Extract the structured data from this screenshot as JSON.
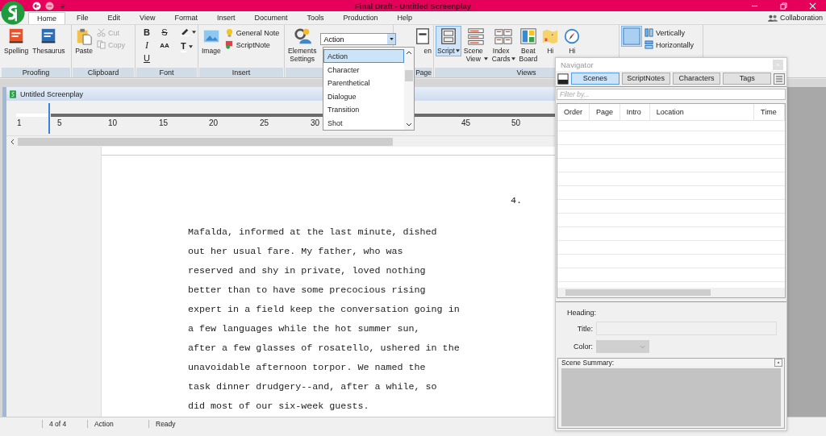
{
  "window": {
    "title": "Final Draft - Untitled Screenplay"
  },
  "menu_tabs": [
    {
      "label": "Home",
      "selected": true
    },
    {
      "label": "File",
      "selected": false
    },
    {
      "label": "Edit",
      "selected": false
    },
    {
      "label": "View",
      "selected": false
    },
    {
      "label": "Format",
      "selected": false
    },
    {
      "label": "Insert",
      "selected": false
    },
    {
      "label": "Document",
      "selected": false
    },
    {
      "label": "Tools",
      "selected": false
    },
    {
      "label": "Production",
      "selected": false
    },
    {
      "label": "Help",
      "selected": false
    }
  ],
  "account": {
    "label": "Collaboration"
  },
  "ribbon": [
    {
      "label": "Proofing",
      "items": [
        {
          "kind": "large",
          "label": "Spelling"
        },
        {
          "kind": "large",
          "label": "Thesaurus"
        }
      ]
    },
    {
      "label": "Clipboard",
      "items": [
        {
          "kind": "large",
          "label": "Paste"
        },
        {
          "kind": "small",
          "label": "Cut",
          "disabled": true
        },
        {
          "kind": "small",
          "label": "Copy",
          "disabled": true
        }
      ]
    },
    {
      "label": "Font",
      "items": [
        {
          "kind": "glyph",
          "text": "B"
        },
        {
          "kind": "glyph",
          "text": "I"
        },
        {
          "kind": "glyph",
          "text": "U"
        },
        {
          "kind": "glyph",
          "text": "S"
        },
        {
          "kind": "glyph",
          "text": "AA"
        },
        {
          "kind": "color"
        },
        {
          "kind": "color",
          "text": "T"
        }
      ]
    },
    {
      "label": "Insert",
      "items": [
        {
          "kind": "large",
          "label": "Image"
        },
        {
          "kind": "small",
          "label": "General Note",
          "disabled": false
        },
        {
          "kind": "small",
          "label": "ScriptNote",
          "disabled": false
        }
      ]
    },
    {
      "items": [
        {
          "kind": "large",
          "label": "Elements Settings"
        },
        {
          "kind": "combo",
          "value": "Action"
        }
      ]
    },
    {
      "label": "Page",
      "items": [
        {
          "kind": "large",
          "label": "en"
        }
      ]
    },
    {
      "label": "Views",
      "items": [
        {
          "kind": "large",
          "label": "Script",
          "selected": true
        },
        {
          "kind": "large",
          "label": "Scene View",
          "selected": false
        },
        {
          "kind": "large",
          "label": "Index Cards",
          "selected": false
        },
        {
          "kind": "large",
          "label": "Beat Board",
          "selected": false
        },
        {
          "kind": "large",
          "label": "Hi",
          "selected": false
        },
        {
          "kind": "large",
          "label": "Hi",
          "selected": false
        }
      ]
    },
    {
      "items": [
        {
          "kind": "large",
          "selected": true
        },
        {
          "kind": "small",
          "label": "Vertically",
          "disabled": false
        },
        {
          "kind": "small",
          "label": "Horizontally",
          "disabled": false
        }
      ]
    }
  ],
  "element_list": [
    {
      "label": "Action",
      "selected": true
    },
    {
      "label": "Character",
      "selected": false
    },
    {
      "label": "Parenthetical",
      "selected": false
    },
    {
      "label": "Dialogue",
      "selected": false
    },
    {
      "label": "Transition",
      "selected": false
    },
    {
      "label": "Shot",
      "selected": false
    }
  ],
  "document": {
    "title": "Untitled Screenplay",
    "ruler": [
      "1",
      "5",
      "10",
      "15",
      "20",
      "25",
      "30",
      "45",
      "50"
    ],
    "page_number": "4.",
    "lines": [
      "Mafalda, informed at the last minute, dished",
      "out her usual fare. My father, who was",
      "reserved and shy in private, loved nothing",
      "better than to have some precocious rising",
      "expert in a field keep the conversation going in",
      "a few languages while the hot summer sun,",
      "after a few glasses of rosatello, ushered in the",
      "unavoidable afternoon torpor. We named the",
      "task dinner drudgery--and, after a while, so",
      "did most of our six-week guests."
    ]
  },
  "navigator": {
    "title": "Navigator",
    "tabs": [
      {
        "label": "Scenes",
        "selected": true
      },
      {
        "label": "ScriptNotes",
        "selected": false
      },
      {
        "label": "Characters",
        "selected": false
      },
      {
        "label": "Tags",
        "selected": false
      }
    ],
    "filter": {
      "placeholder": "Filter by..."
    },
    "columns": [
      "Order",
      "Page",
      "Intro",
      "Location",
      "Time"
    ],
    "heading_label": "Heading:",
    "title_label": "Title:",
    "color_label": "Color:",
    "summary_label": "Scene Summary:"
  },
  "status_bar": {
    "page": "4 of 4",
    "element": "Action",
    "state": "Ready"
  }
}
